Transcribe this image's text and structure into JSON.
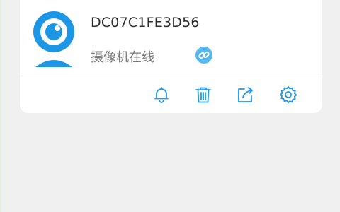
{
  "device": {
    "name": "DC07C1FE3D56",
    "status": "摄像机在线"
  },
  "icons": {
    "camera": "webcam-icon",
    "link": "link-icon",
    "bell": "bell-icon",
    "trash": "trash-icon",
    "share": "share-icon",
    "settings": "gear-icon"
  },
  "colors": {
    "accent": "#1e96e6",
    "link_badge": "#55b8f2",
    "background": "#f0f0f0",
    "card": "#ffffff",
    "name_text": "#2b2b2b",
    "status_text": "#7a7a7a"
  }
}
